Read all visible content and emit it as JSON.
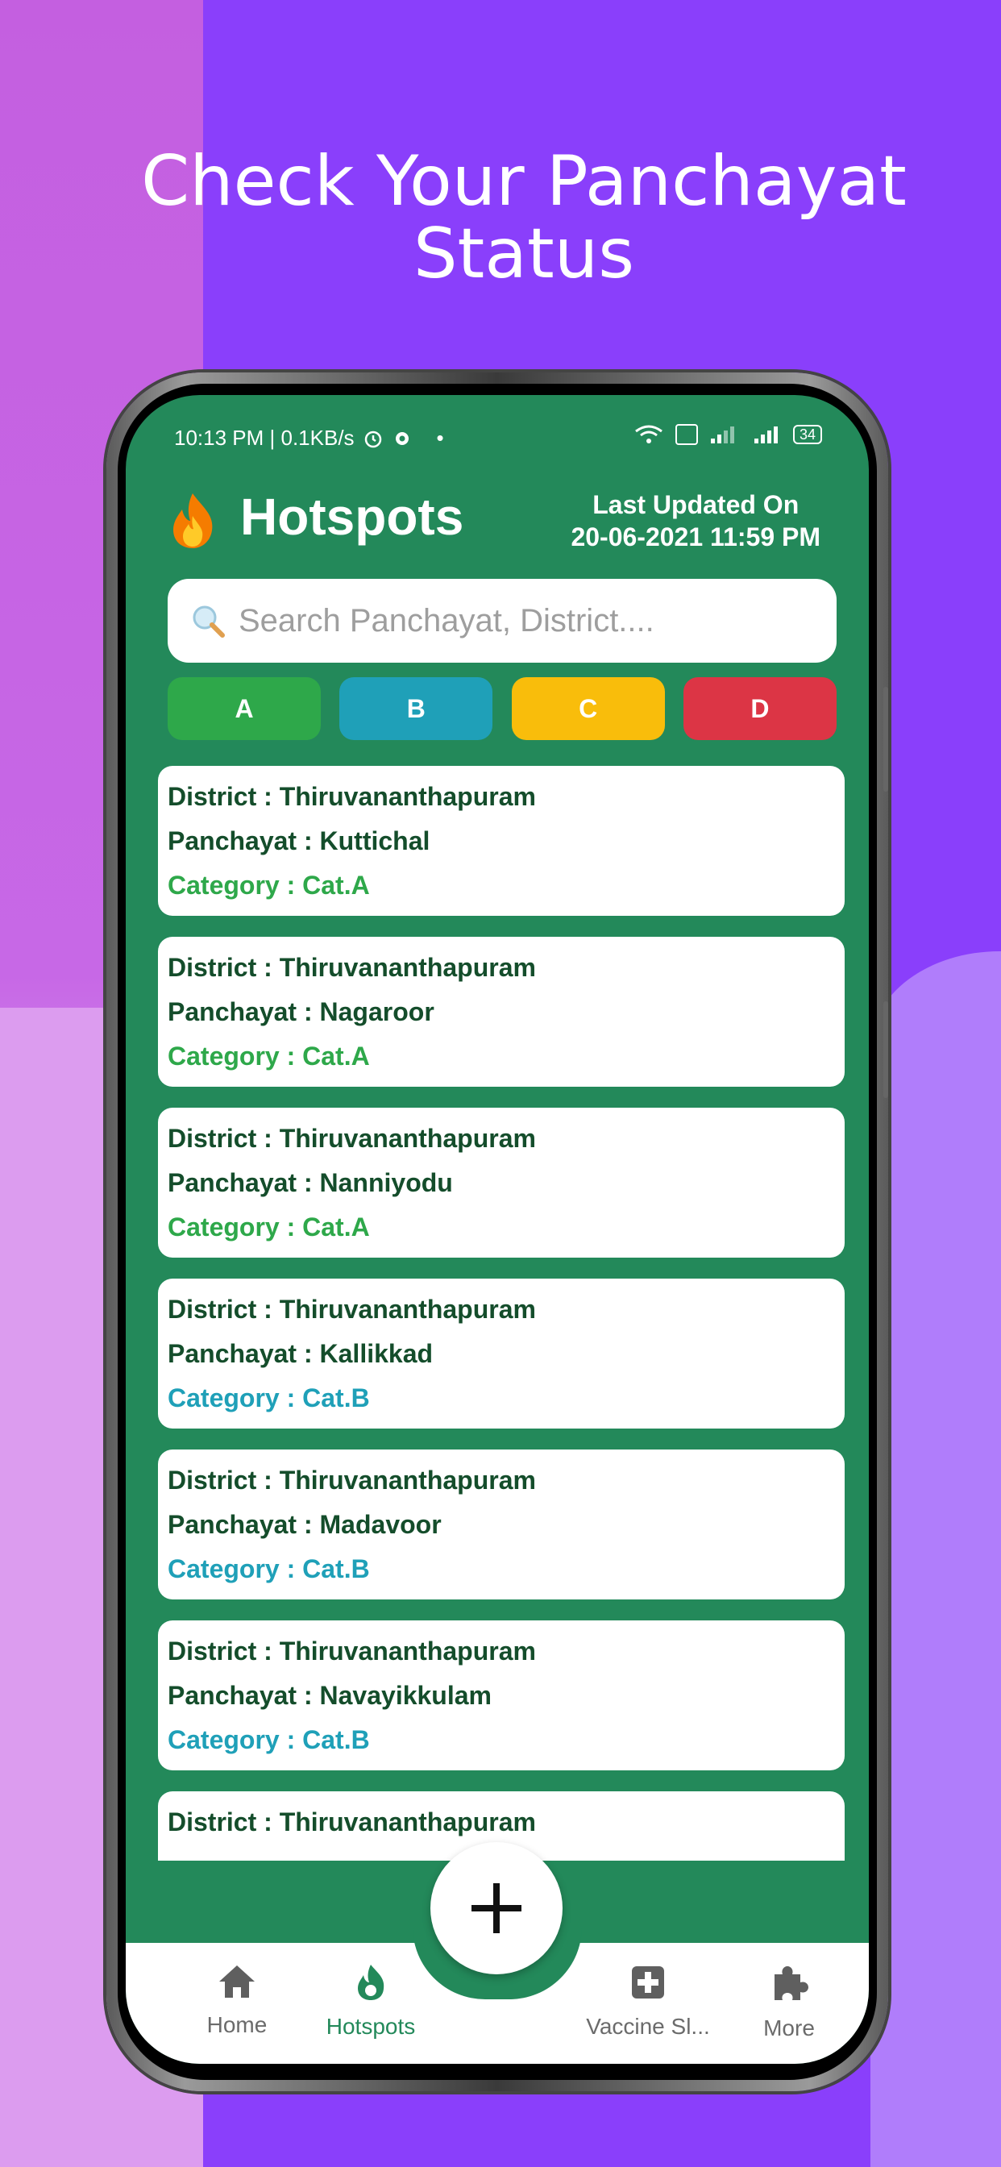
{
  "promo": {
    "headline_line1": "Check Your Panchayat",
    "headline_line2": "Status"
  },
  "status_bar": {
    "left": "10:13 PM | 0.1KB/s",
    "battery": "34"
  },
  "header": {
    "title": "Hotspots",
    "updated_label": "Last Updated On",
    "updated_value": "20-06-2021 11:59 PM"
  },
  "search": {
    "placeholder": "Search Panchayat, District...."
  },
  "categories": [
    {
      "label": "A",
      "color": "#2ea84a"
    },
    {
      "label": "B",
      "color": "#1fa0b8"
    },
    {
      "label": "C",
      "color": "#f9bd0b"
    },
    {
      "label": "D",
      "color": "#dc3545"
    }
  ],
  "list": [
    {
      "district": "District : Thiruvananthapuram",
      "panchayat": "Panchayat : Kuttichal",
      "category": "Category : Cat.A"
    },
    {
      "district": "District : Thiruvananthapuram",
      "panchayat": "Panchayat : Nagaroor",
      "category": "Category : Cat.A"
    },
    {
      "district": "District : Thiruvananthapuram",
      "panchayat": "Panchayat : Nanniyodu",
      "category": "Category : Cat.A"
    },
    {
      "district": "District : Thiruvananthapuram",
      "panchayat": "Panchayat : Kallikkad",
      "category": "Category : Cat.B"
    },
    {
      "district": "District : Thiruvananthapuram",
      "panchayat": "Panchayat : Madavoor",
      "category": "Category : Cat.B"
    },
    {
      "district": "District : Thiruvananthapuram",
      "panchayat": "Panchayat : Navayikkulam",
      "category": "Category : Cat.B"
    },
    {
      "district": "District : Thiruvananthapuram",
      "panchayat": "",
      "category": ""
    }
  ],
  "nav": {
    "home": "Home",
    "hotspots": "Hotspots",
    "vaccine": "Vaccine Sl...",
    "more": "More"
  },
  "colors": {
    "primary_green": "#23895a",
    "text_dark_green": "#144d2b",
    "background_purple": "#8a3ffb"
  },
  "icons": [
    "flame-icon",
    "search-icon",
    "plus-icon",
    "home-icon",
    "hotspot-icon",
    "medical-cross-icon",
    "puzzle-icon",
    "alarm-icon",
    "gear-icon",
    "wifi-icon",
    "signal-icon",
    "battery-icon"
  ]
}
